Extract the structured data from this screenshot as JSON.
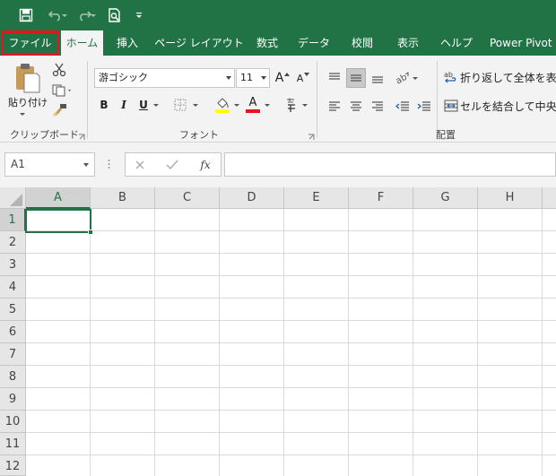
{
  "qat": {
    "icons": [
      "save-icon",
      "undo-icon",
      "redo-icon",
      "print-preview-icon",
      "customize-qat-icon"
    ]
  },
  "tabs": [
    {
      "id": "file",
      "label": "ファイル"
    },
    {
      "id": "home",
      "label": "ホーム"
    },
    {
      "id": "insert",
      "label": "挿入"
    },
    {
      "id": "page-layout",
      "label": "ページ レイアウト"
    },
    {
      "id": "formulas",
      "label": "数式"
    },
    {
      "id": "data",
      "label": "データ"
    },
    {
      "id": "review",
      "label": "校閲"
    },
    {
      "id": "view",
      "label": "表示"
    },
    {
      "id": "help",
      "label": "ヘルプ"
    },
    {
      "id": "power-pivot",
      "label": "Power Pivot"
    }
  ],
  "ribbon": {
    "clipboard": {
      "paste_label": "貼り付け",
      "group_label": "クリップボード"
    },
    "font": {
      "font_name": "游ゴシック",
      "font_size": "11",
      "bold": "B",
      "italic": "I",
      "underline": "U",
      "grow_a": "A",
      "shrink_a": "A",
      "font_color_a": "A",
      "group_label": "フォント"
    },
    "alignment": {
      "wrap_text_label": "折り返して全体を表示",
      "merge_center_label": "セルを結合して中央揃",
      "group_label": "配置"
    }
  },
  "formula_bar": {
    "name_box": "A1",
    "fx": "fx",
    "formula": ""
  },
  "grid": {
    "columns": [
      "A",
      "B",
      "C",
      "D",
      "E",
      "F",
      "G",
      "H"
    ],
    "rows": [
      "1",
      "2",
      "3",
      "4",
      "5",
      "6",
      "7",
      "8",
      "9",
      "10",
      "11",
      "12"
    ],
    "selected_cell": "A1"
  },
  "colors": {
    "excel_green": "#217346",
    "highlight_red": "#e5141e",
    "ribbon_bg": "#f3f3f3"
  }
}
